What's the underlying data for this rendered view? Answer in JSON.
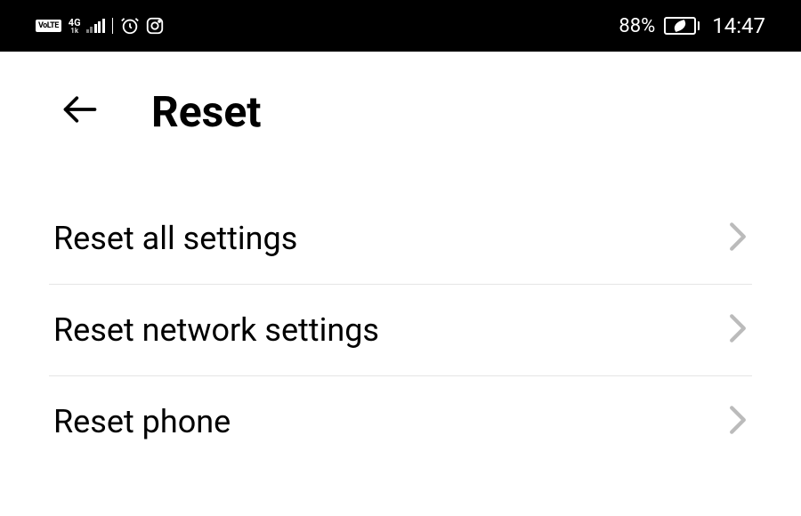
{
  "statusbar": {
    "volte": "VoLTE",
    "network_gen": "4G",
    "network_sub": "1k",
    "battery_pct": "88%",
    "time": "14:47"
  },
  "header": {
    "title": "Reset"
  },
  "items": [
    {
      "label": "Reset all settings"
    },
    {
      "label": "Reset network settings"
    },
    {
      "label": "Reset phone"
    }
  ]
}
